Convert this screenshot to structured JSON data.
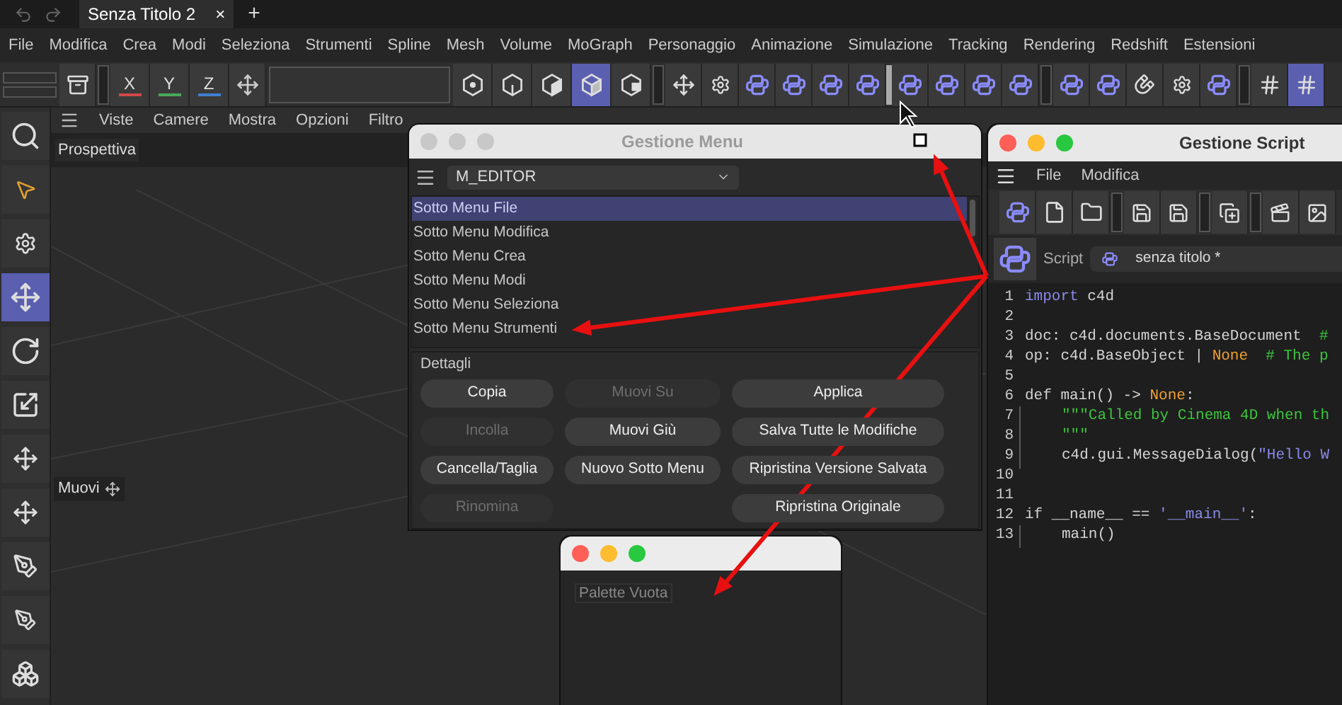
{
  "tab_bar": {
    "tabs": [
      {
        "label": "Senza Titolo 2",
        "selected": true
      }
    ],
    "close": "×",
    "add": "+"
  },
  "menu_bar": [
    "File",
    "Modifica",
    "Crea",
    "Modi",
    "Seleziona",
    "Strumenti",
    "Spline",
    "Mesh",
    "Volume",
    "MoGraph",
    "Personaggio",
    "Animazione",
    "Simulazione",
    "Tracking",
    "Rendering",
    "Redshift",
    "Estensioni"
  ],
  "toolbar": {
    "axes": [
      {
        "label": "X",
        "color": "#d04848"
      },
      {
        "label": "Y",
        "color": "#49a85a"
      },
      {
        "label": "Z",
        "color": "#3f7fd0"
      }
    ],
    "modes": [
      {
        "selected": false
      },
      {
        "selected": false
      },
      {
        "selected": false
      },
      {
        "selected": true
      },
      {
        "selected": false
      }
    ]
  },
  "left_tools": [
    {
      "selected": false
    },
    {
      "selected": false
    },
    {
      "selected": false
    },
    {
      "selected": true
    },
    {
      "selected": false
    },
    {
      "selected": false
    },
    {
      "selected": false
    },
    {
      "selected": false
    },
    {
      "selected": false
    },
    {
      "selected": false
    },
    {
      "selected": false
    }
  ],
  "viewport": {
    "menu": [
      "Viste",
      "Camere",
      "Mostra",
      "Opzioni",
      "Filtro"
    ],
    "camera_label": "Prospettiva",
    "tooltip": "Muovi"
  },
  "menu_manager": {
    "title": "Gestione Menu",
    "dropdown": "M_EDITOR",
    "items": [
      {
        "label": "Sotto Menu File",
        "selected": true
      },
      {
        "label": "Sotto Menu Modifica",
        "selected": false
      },
      {
        "label": "Sotto Menu Crea",
        "selected": false
      },
      {
        "label": "Sotto Menu Modi",
        "selected": false
      },
      {
        "label": "Sotto Menu Seleziona",
        "selected": false
      },
      {
        "label": "Sotto Menu Strumenti",
        "selected": false
      }
    ],
    "section": "Dettagli",
    "button_columns": [
      [
        {
          "label": "Copia",
          "disabled": false
        },
        {
          "label": "Incolla",
          "disabled": true
        },
        {
          "label": "Cancella/Taglia",
          "disabled": false
        },
        {
          "label": "Rinomina",
          "disabled": true
        }
      ],
      [
        {
          "label": "Muovi Su",
          "disabled": true
        },
        {
          "label": "Muovi Giù",
          "disabled": false
        },
        {
          "label": "Nuovo Sotto Menu",
          "disabled": false
        }
      ],
      [
        {
          "label": "Applica",
          "disabled": false
        },
        {
          "label": "Salva Tutte le Modifiche",
          "disabled": false
        },
        {
          "label": "Ripristina Versione Salvata",
          "disabled": false
        },
        {
          "label": "Ripristina Originale",
          "disabled": false
        }
      ]
    ]
  },
  "script_manager": {
    "title": "Gestione Script",
    "menu": [
      "File",
      "Modifica"
    ],
    "script_label": "Script",
    "script_name": "senza titolo *",
    "code": [
      {
        "number": "1",
        "tokens": [
          {
            "kind": "keyword",
            "text": "import"
          },
          {
            "kind": "plain",
            "text": " c4d"
          }
        ]
      },
      {
        "number": "2"
      },
      {
        "number": "3",
        "tokens": [
          {
            "kind": "plain",
            "text": "doc: c4d.documents.BaseDocument  "
          },
          {
            "kind": "comment",
            "text": "#"
          }
        ]
      },
      {
        "number": "4",
        "tokens": [
          {
            "kind": "plain",
            "text": "op: c4d.BaseObject | "
          },
          {
            "kind": "constant",
            "text": "None"
          },
          {
            "kind": "comment",
            "text": "  # The p"
          }
        ]
      },
      {
        "number": "5"
      },
      {
        "number": "6",
        "tokens": [
          {
            "kind": "plain",
            "text": "def main() -> "
          },
          {
            "kind": "constant",
            "text": "None"
          },
          {
            "kind": "plain",
            "text": ":"
          }
        ]
      },
      {
        "number": "7",
        "indented": true,
        "tokens": [
          {
            "kind": "docstring",
            "text": "\"\"\"Called by Cinema 4D when th"
          }
        ]
      },
      {
        "number": "8",
        "indented": true,
        "tokens": [
          {
            "kind": "docstring",
            "text": "\"\"\""
          }
        ]
      },
      {
        "number": "9",
        "indented": true,
        "tokens": [
          {
            "kind": "plain",
            "text": "c4d.gui.MessageDialog("
          },
          {
            "kind": "string",
            "text": "\"Hello W"
          }
        ]
      },
      {
        "number": "10"
      },
      {
        "number": "11"
      },
      {
        "number": "12",
        "tokens": [
          {
            "kind": "plain",
            "text": "if __name__ == "
          },
          {
            "kind": "string",
            "text": "'__main__'"
          },
          {
            "kind": "plain",
            "text": ":"
          }
        ]
      },
      {
        "number": "13",
        "indented": true,
        "tokens": [
          {
            "kind": "plain",
            "text": "main()"
          }
        ]
      }
    ]
  },
  "palette": {
    "label": "Palette Vuota"
  }
}
